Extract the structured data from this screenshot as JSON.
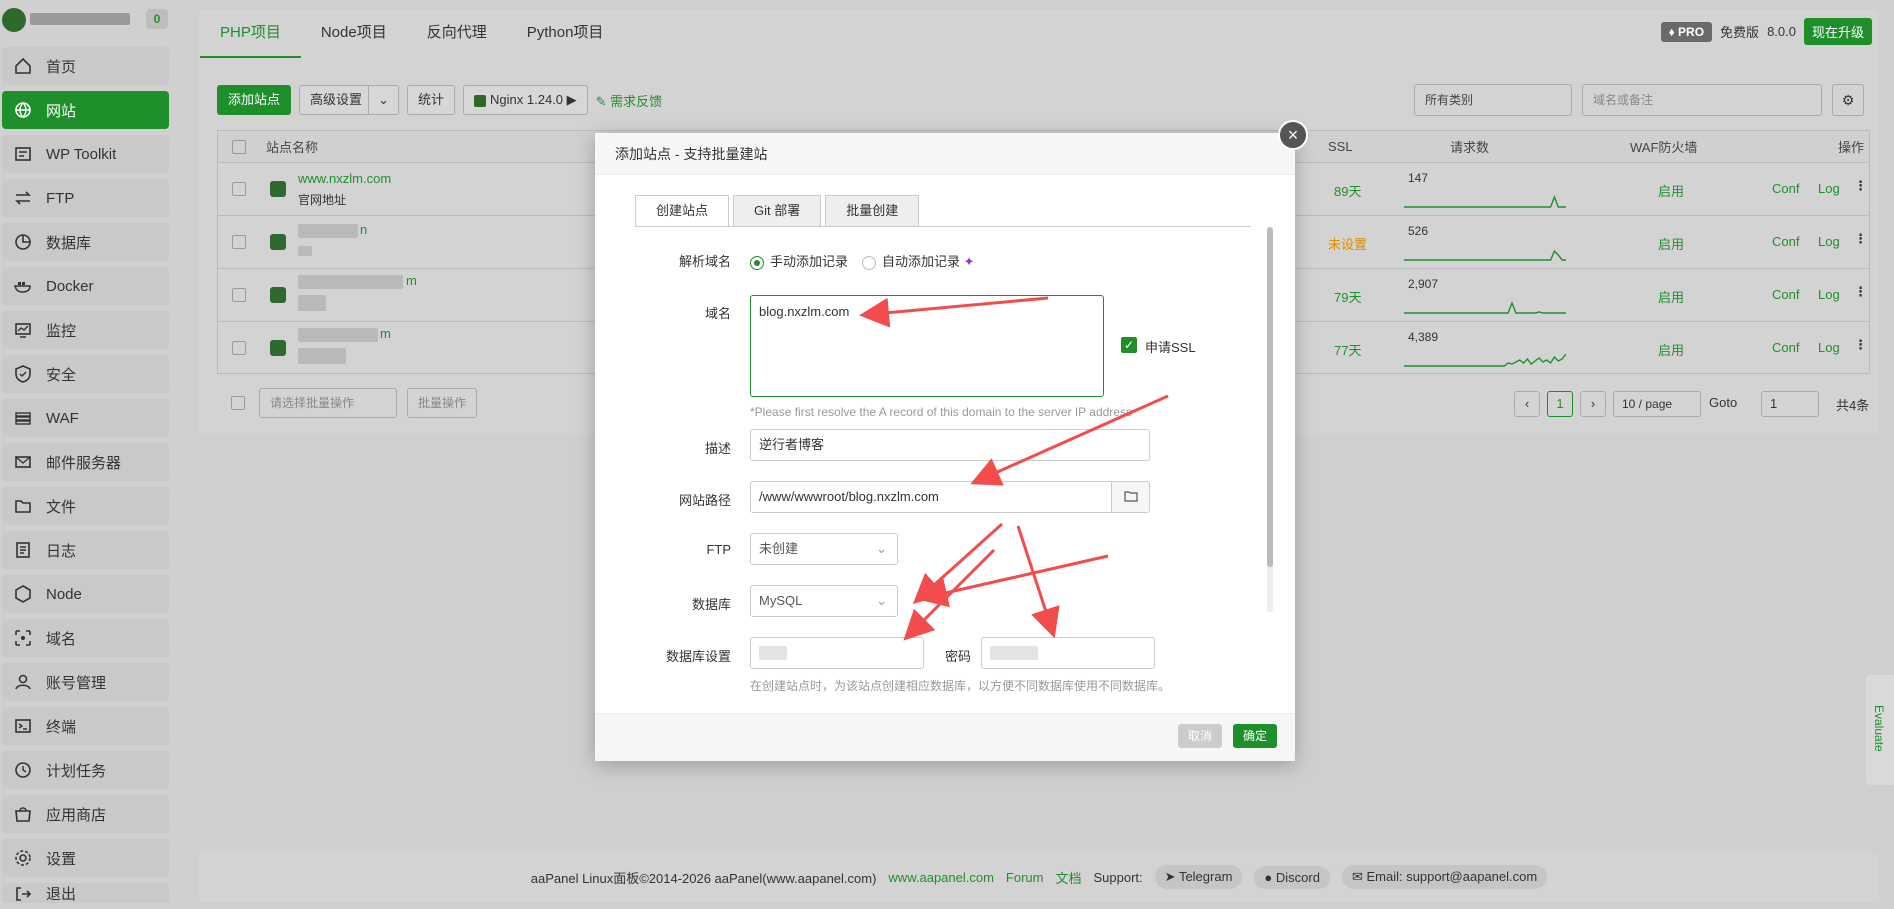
{
  "sidebar": {
    "badge": "0",
    "items": [
      {
        "label": "首页",
        "icon": "home-icon"
      },
      {
        "label": "网站",
        "icon": "globe-icon"
      },
      {
        "label": "WP Toolkit",
        "icon": "wp-icon"
      },
      {
        "label": "FTP",
        "icon": "ftp-icon"
      },
      {
        "label": "数据库",
        "icon": "database-icon"
      },
      {
        "label": "Docker",
        "icon": "docker-icon"
      },
      {
        "label": "监控",
        "icon": "monitor-icon"
      },
      {
        "label": "安全",
        "icon": "shield-icon"
      },
      {
        "label": "WAF",
        "icon": "waf-icon"
      },
      {
        "label": "邮件服务器",
        "icon": "mail-icon"
      },
      {
        "label": "文件",
        "icon": "folder-icon"
      },
      {
        "label": "日志",
        "icon": "log-icon"
      },
      {
        "label": "Node",
        "icon": "node-icon"
      },
      {
        "label": "域名",
        "icon": "domain-icon"
      },
      {
        "label": "账号管理",
        "icon": "user-icon"
      },
      {
        "label": "终端",
        "icon": "terminal-icon"
      },
      {
        "label": "计划任务",
        "icon": "clock-icon"
      },
      {
        "label": "应用商店",
        "icon": "store-icon"
      },
      {
        "label": "设置",
        "icon": "gear-icon"
      },
      {
        "label": "退出",
        "icon": "logout-icon"
      }
    ]
  },
  "header": {
    "tabs": [
      "PHP项目",
      "Node项目",
      "反向代理",
      "Python项目"
    ],
    "pro": "PRO",
    "edition": "免费版",
    "version": "8.0.0",
    "upgrade": "现在升级"
  },
  "toolbar": {
    "add_site": "添加站点",
    "advanced": "高级设置",
    "stats": "统计",
    "nginx": "Nginx 1.24.0",
    "feedback": "需求反馈",
    "category": "所有类别",
    "search_placeholder": "域名或备注"
  },
  "table": {
    "headers": {
      "name": "站点名称",
      "ssl": "SSL",
      "requests": "请求数",
      "waf": "WAF防火墙",
      "ops": "操作"
    },
    "rows": [
      {
        "domain": "www.nxzlm.com",
        "note": "官网地址",
        "ssl": "89天",
        "requests": "147",
        "waf": "启用"
      },
      {
        "domain": "n",
        "note": "",
        "ssl": "未设置",
        "requests": "526",
        "waf": "启用"
      },
      {
        "domain": "m",
        "note": "",
        "ssl": "79天",
        "requests": "2,907",
        "waf": "启用"
      },
      {
        "domain": "m",
        "note": "",
        "ssl": "77天",
        "requests": "4,389",
        "waf": "启用"
      }
    ],
    "conf": "Conf",
    "log": "Log"
  },
  "pager": {
    "batch_select": "请选择批量操作",
    "batch_btn": "批量操作",
    "page": "1",
    "per_page": "10 / page",
    "goto": "Goto",
    "goto_value": "1",
    "total": "共4条"
  },
  "footer": {
    "copyright": "aaPanel Linux面板©2014-2026 aaPanel(www.aapanel.com)",
    "site": "www.aapanel.com",
    "forum": "Forum",
    "docs": "文档",
    "support": "Support:",
    "telegram": "Telegram",
    "discord": "Discord",
    "email": "Email: support@aapanel.com"
  },
  "modal": {
    "title": "添加站点 - 支持批量建站",
    "tabs": [
      "创建站点",
      "Git 部署",
      "批量创建"
    ],
    "dns_label": "解析域名",
    "dns_manual": "手动添加记录",
    "dns_auto": "自动添加记录",
    "domain_label": "域名",
    "domain_value": "blog.nxzlm.com",
    "ssl_label": "申请SSL",
    "domain_hint": "*Please first resolve the A record of this domain to the server IP address",
    "desc_label": "描述",
    "desc_value": "逆行者博客",
    "path_label": "网站路径",
    "path_value": "/www/wwwroot/blog.nxzlm.com",
    "ftp_label": "FTP",
    "ftp_value": "未创建",
    "db_label": "数据库",
    "db_value": "MySQL",
    "dbset_label": "数据库设置",
    "pwd_label": "密码",
    "db_hint": "在创建站点时，为该站点创建相应数据库，以方便不同数据库使用不同数据库。",
    "cancel": "取消",
    "ok": "确定"
  },
  "evaluate": "Evaluate",
  "colors": {
    "accent": "#1f8f2c",
    "warn": "#e08a00",
    "arrow": "#f24c4c"
  }
}
